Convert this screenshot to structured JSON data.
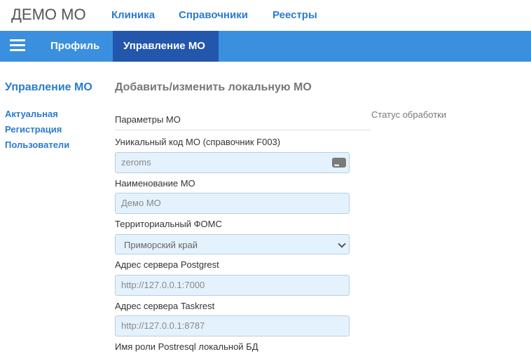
{
  "header": {
    "brand": "ДЕМО МО",
    "nav": [
      "Клиника",
      "Справочники",
      "Реестры"
    ]
  },
  "bluebar": {
    "menu_icon": "hamburger-icon",
    "tabs": [
      {
        "label": "Профиль",
        "active": false
      },
      {
        "label": "Управление МО",
        "active": true
      }
    ]
  },
  "sidebar": {
    "title": "Управление МО",
    "items": [
      "Актуальная",
      "Регистрация",
      "Пользователи"
    ]
  },
  "main": {
    "title": "Добавить/изменить локальную МО",
    "section": "Параметры МО",
    "status_label": "Статус обработки",
    "fields": [
      {
        "label": "Уникальный код МО (справочник F003)",
        "placeholder": "zeroms",
        "icon": "ellipsis-badge-icon"
      },
      {
        "label": "Наименование МО",
        "placeholder": "Демо МО"
      },
      {
        "label": "Территориальный ФОМС",
        "value": "Приморский край",
        "type": "select"
      },
      {
        "label": "Адрес сервера Postgrest",
        "placeholder": "http://127.0.0.1:7000"
      },
      {
        "label": "Адрес сервера Taskrest",
        "placeholder": "http://127.0.0.1:8787"
      },
      {
        "label": "Имя роли Postresql локальной БД"
      }
    ]
  },
  "colors": {
    "accent": "#2a7bd0",
    "bar": "#3b8fdf",
    "active_tab": "#2356ad",
    "input_bg": "#e4f2fd"
  }
}
